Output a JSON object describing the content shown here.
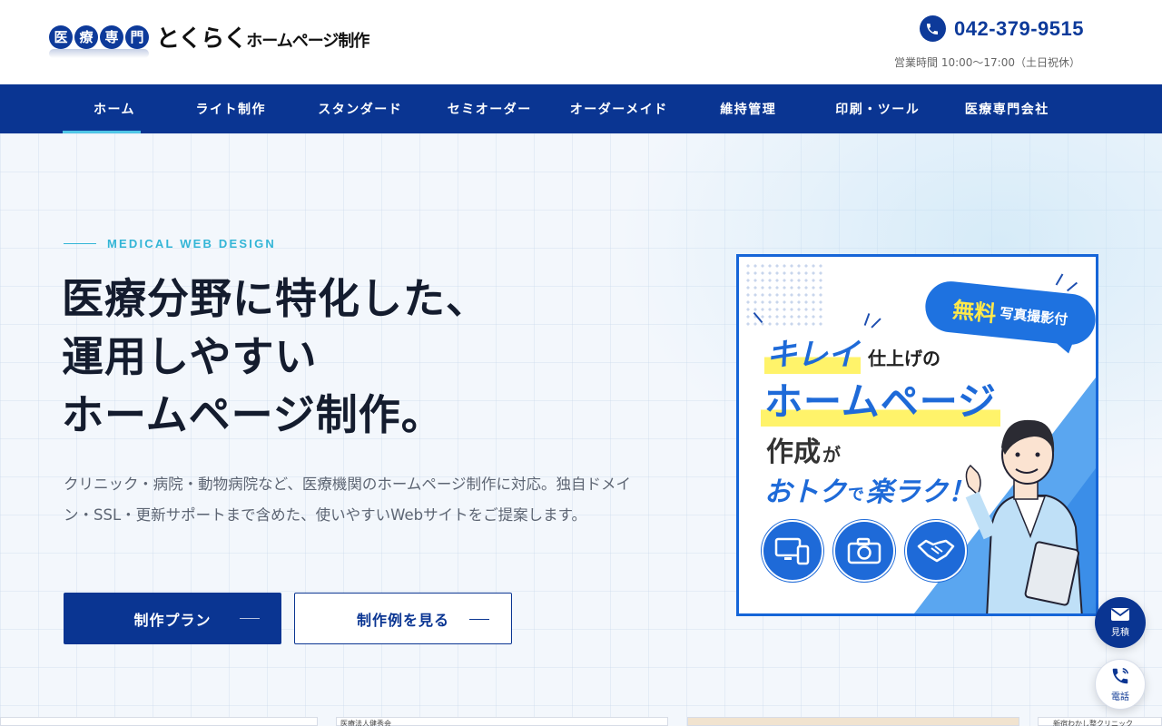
{
  "header": {
    "logo": {
      "badges": [
        "医",
        "療",
        "専",
        "門"
      ],
      "main": "とくらく",
      "sub": "ホームページ制作"
    },
    "phone": {
      "icon": "phone-icon",
      "number": "042-379-9515"
    },
    "hours": "営業時間 10:00〜17:00（土日祝休）"
  },
  "nav": {
    "items": [
      {
        "label": "ホーム",
        "active": true
      },
      {
        "label": "ライト制作"
      },
      {
        "label": "スタンダード"
      },
      {
        "label": "セミオーダー"
      },
      {
        "label": "オーダーメイド"
      },
      {
        "label": "維持管理"
      },
      {
        "label": "印刷・ツール"
      },
      {
        "label": "医療専門会社"
      }
    ]
  },
  "hero": {
    "eyebrow": "MEDICAL WEB DESIGN",
    "headline": [
      "医療分野に特化した、",
      "運用しやすい",
      "ホームページ制作。"
    ],
    "description": "クリニック・病院・動物病院など、医療機関のホームページ制作に対応。独自ドメイン・SSL・更新サポートまで含めた、使いやすいWebサイトをご提案します。",
    "buttons": {
      "primary": "制作プラン",
      "secondary": "制作例を見る"
    }
  },
  "banner": {
    "free": "無料",
    "photo": "写真撮影付",
    "kirei": "キレイ",
    "shiage": "仕上げの",
    "homepage": "ホームページ",
    "sakusei": "作成",
    "ga": "が",
    "otoku": "おトク",
    "de": "で",
    "raku": "楽ラク！",
    "icons": [
      "devices-icon",
      "camera-icon",
      "handshake-icon"
    ]
  },
  "floating": {
    "estimate": "見積",
    "tel": "電話"
  },
  "thumbnails": [
    "医療法人健秀会",
    "新宿わかし整クリニック"
  ],
  "colors": {
    "brand": "#0a3592",
    "accent": "#33b5d6",
    "banner_blue": "#1e6ad8",
    "highlight": "#fff36a"
  }
}
